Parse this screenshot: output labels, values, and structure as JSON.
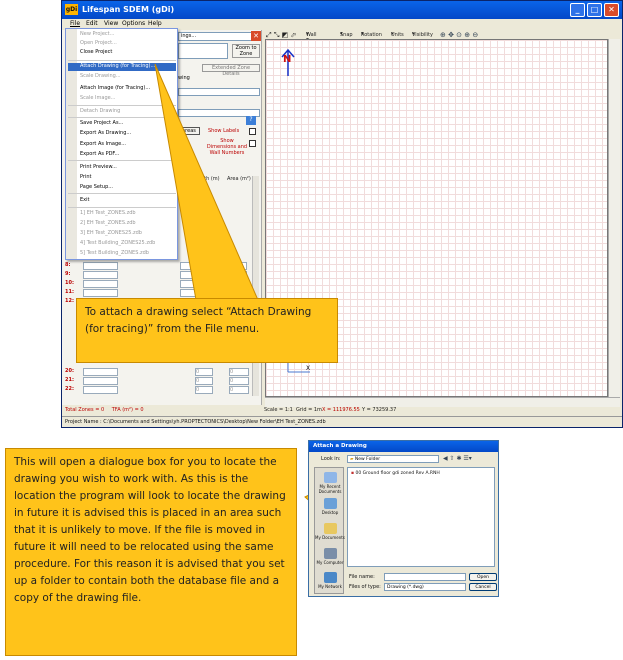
{
  "app": {
    "title": "Lifespan SDEM (gDi)",
    "logo": "gDi",
    "menu_bar": [
      "File",
      "Edit",
      "View",
      "Options",
      "Help"
    ]
  },
  "file_menu": {
    "items": [
      {
        "label": "New Project...",
        "disabled": true
      },
      {
        "label": "Open Project...",
        "disabled": true
      },
      {
        "label": "Close Project",
        "disabled": false
      },
      {
        "sep": true
      },
      {
        "label": "Attach Drawing (for Tracing)...",
        "disabled": false,
        "highlighted": true
      },
      {
        "label": "Scale Drawing...",
        "disabled": true
      },
      {
        "label": "Attach Image (for Tracing)...",
        "disabled": false
      },
      {
        "label": "Scale Image...",
        "disabled": true
      },
      {
        "sep": true
      },
      {
        "label": "Detach Drawing",
        "disabled": true
      },
      {
        "sep": true
      },
      {
        "label": "Save Project As...",
        "disabled": false
      },
      {
        "label": "Export As Drawing...",
        "disabled": false
      },
      {
        "label": "Export As Image...",
        "disabled": false
      },
      {
        "label": "Export As PDF...",
        "disabled": false
      },
      {
        "sep": true
      },
      {
        "label": "Print Preview...",
        "disabled": false
      },
      {
        "label": "Print",
        "disabled": false
      },
      {
        "label": "Page Setup...",
        "disabled": false
      },
      {
        "sep": true
      },
      {
        "label": "Exit",
        "disabled": false
      },
      {
        "sep": true
      },
      {
        "label": "1] EH Test_ZONES.zdb",
        "disabled": true
      },
      {
        "label": "2] EH Test_ZONES.zdb",
        "disabled": true
      },
      {
        "label": "3] EH Test_ZONES25.zdb",
        "disabled": true
      },
      {
        "label": "4] Test Building_ZONES25.zdb",
        "disabled": true
      },
      {
        "label": "5] Test Building_ZONES.zdb",
        "disabled": true
      }
    ]
  },
  "left_panel": {
    "buildings_partial": "ings...",
    "zoom_to_zone": "Zoom to Zone",
    "extended_zone_details": "Extended Zone Details",
    "drawing_partial": "wing",
    "areas_btn": "areas",
    "show_labels": "Show Labels",
    "show_dimensions": "Show Dimensions and Wall Numbers",
    "col_length": "Length (m)",
    "col_area": "Area (m²)",
    "visible_rows": [
      "8:",
      "9:",
      "10:",
      "11:",
      "12:"
    ],
    "lower_rows": [
      "20:",
      "21:",
      "22:"
    ],
    "zero": "0",
    "total_zones": "Total Zones = 0",
    "tfa": "TFA (m²) = 0"
  },
  "toolbar": {
    "wall_type": "Wall Type",
    "snap": "Snap",
    "rotation": "Rotation",
    "units": "Units",
    "visibility": "Visibility"
  },
  "canvas": {
    "north_label": "N",
    "axis_y": "Y",
    "axis_x": "X"
  },
  "status": {
    "scale": "Scale = 1:1",
    "grid": "Grid = 1m",
    "x_coord": "X = 111976.55",
    "y_coord": "Y = 73259.37",
    "project_name": "Project Name : C:\\Documents and Settings\\yh.PROPTECTONICS\\Desktop\\New Folder\\EH Test_ZONES.zdb"
  },
  "callout_top": "To attach a drawing select “Attach Drawing (for tracing)” from the File menu.",
  "callout_bottom": "This will open a dialogue box for you to locate the drawing you wish to work with. As this is the location the program will look to locate the drawing in future it is advised this is placed in an area such that it is unlikely to move. If the file is moved in future it will need to be relocated using the same procedure. For this reason it is advised that you set up a folder to contain both the database file and a copy of the drawing file.",
  "dialog": {
    "title": "Attach a Drawing",
    "look_in_label": "Look in:",
    "look_in_value": "New Folder",
    "file_item": "00 Ground floor gdi zoned Rev A.RNH",
    "places": [
      "My Recent Documents",
      "Desktop",
      "My Documents",
      "My Computer",
      "My Network"
    ],
    "file_name_label": "File name:",
    "file_type_label": "Files of type:",
    "file_type_value": "Drawing (*.dwg)",
    "open_btn": "Open",
    "cancel_btn": "Cancel"
  },
  "colors": {
    "callout_fill": "#ffc31a",
    "xp_blue": "#0a64e8",
    "menu_highlight": "#316ac5",
    "north_arrow": "#1530c8",
    "north_letter": "#d01010"
  }
}
